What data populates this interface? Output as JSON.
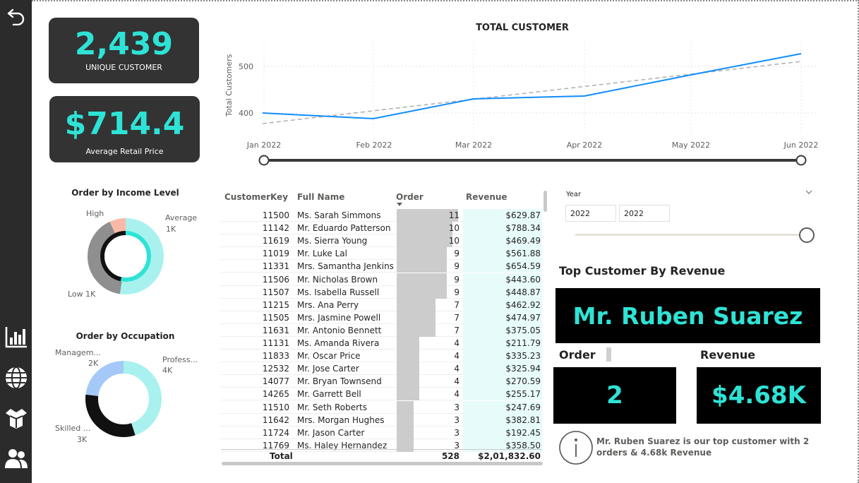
{
  "nav": {
    "back_icon": "back-arrow-icon",
    "items": [
      "bar-chart-icon",
      "globe-icon",
      "box-icon",
      "people-icon"
    ]
  },
  "kpi": {
    "unique_customer": {
      "value": "2,439",
      "label": "UNIQUE CUSTOMER"
    },
    "avg_price": {
      "value": "$714.4",
      "label": "Average Retail Price"
    }
  },
  "line_chart": {
    "title": "TOTAL CUSTOMER",
    "ylabel": "Total Customers",
    "y_ticks": [
      "500",
      "400"
    ],
    "x_ticks": [
      "Jan 2022",
      "Feb 2022",
      "Mar 2022",
      "Apr 2022",
      "May 2022",
      "Jun 2022"
    ]
  },
  "income_donut": {
    "title": "Order by Income Level",
    "labels": {
      "high": "High",
      "average": "Average",
      "average_val": "1K",
      "low": "Low 1K"
    }
  },
  "occupation_donut": {
    "title": "Order by Occupation",
    "labels": {
      "mgmt": "Managem...",
      "mgmt_val": "2K",
      "prof": "Profess...",
      "prof_val": "4K",
      "skilled": "Skilled ...",
      "skilled_val": "3K"
    }
  },
  "table": {
    "headers": {
      "key": "CustomerKey",
      "name": "Full Name",
      "order": "Order",
      "revenue": "Revenue"
    },
    "rows": [
      {
        "key": "11500",
        "name": "Ms. Sarah Simmons",
        "order": "11",
        "revenue": "$629.87"
      },
      {
        "key": "11142",
        "name": "Mr. Eduardo Patterson",
        "order": "10",
        "revenue": "$788.34"
      },
      {
        "key": "11619",
        "name": "Ms. Sierra Young",
        "order": "10",
        "revenue": "$469.49"
      },
      {
        "key": "11019",
        "name": "Mr. Luke Lal",
        "order": "9",
        "revenue": "$561.88"
      },
      {
        "key": "11331",
        "name": "Mrs. Samantha Jenkins",
        "order": "9",
        "revenue": "$654.59"
      },
      {
        "key": "11506",
        "name": "Mr. Nicholas Brown",
        "order": "9",
        "revenue": "$443.60"
      },
      {
        "key": "11507",
        "name": "Ms. Isabella Russell",
        "order": "9",
        "revenue": "$448.87"
      },
      {
        "key": "11215",
        "name": "Mrs. Ana Perry",
        "order": "7",
        "revenue": "$462.92"
      },
      {
        "key": "11505",
        "name": "Mrs. Jasmine Powell",
        "order": "7",
        "revenue": "$474.97"
      },
      {
        "key": "11631",
        "name": "Mr. Antonio Bennett",
        "order": "7",
        "revenue": "$375.05"
      },
      {
        "key": "11131",
        "name": "Ms. Amanda Rivera",
        "order": "4",
        "revenue": "$211.79"
      },
      {
        "key": "11833",
        "name": "Mr. Oscar Price",
        "order": "4",
        "revenue": "$335.23"
      },
      {
        "key": "12532",
        "name": "Mr. Jose Carter",
        "order": "4",
        "revenue": "$325.94"
      },
      {
        "key": "14077",
        "name": "Mr. Bryan Townsend",
        "order": "4",
        "revenue": "$270.59"
      },
      {
        "key": "14265",
        "name": "Mr. Garrett Bell",
        "order": "4",
        "revenue": "$255.17"
      },
      {
        "key": "11510",
        "name": "Mr. Seth Roberts",
        "order": "3",
        "revenue": "$247.69"
      },
      {
        "key": "11642",
        "name": "Mrs. Morgan Hughes",
        "order": "3",
        "revenue": "$382.81"
      },
      {
        "key": "11724",
        "name": "Mr. Jason Carter",
        "order": "3",
        "revenue": "$192.45"
      },
      {
        "key": "11769",
        "name": "Ms. Haley Hernandez",
        "order": "3",
        "revenue": "$358.50"
      }
    ],
    "total": {
      "label": "Total",
      "order": "528",
      "revenue": "$2,01,832.60"
    }
  },
  "slicer": {
    "title": "Year",
    "from": "2022",
    "to": "2022",
    "chevron_icon": "chevron-down-icon"
  },
  "top_customer": {
    "title": "Top Customer By Revenue",
    "name": "Mr. Ruben Suarez",
    "order_label": "Order",
    "order_value": "2",
    "revenue_label": "Revenue",
    "revenue_value": "$4.68K",
    "info_icon": "info-icon",
    "note": "Mr. Ruben Suarez is our top customer with 2 orders & 4.68k Revenue"
  },
  "colors": {
    "accent": "#2ee3d6",
    "line_blue": "#118dff",
    "card_bg": "#333333",
    "nav_bg": "#2b2b2b"
  }
}
